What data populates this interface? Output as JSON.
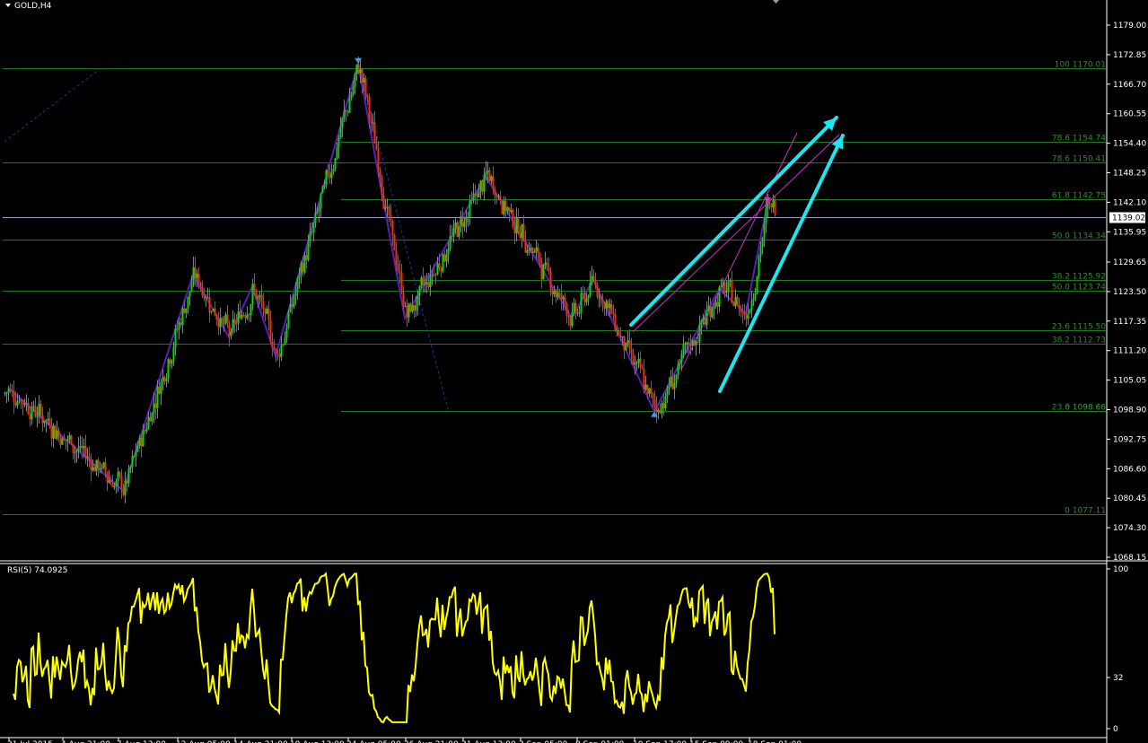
{
  "window": {
    "symbol_label": "GOLD,H4"
  },
  "chart_data": [
    {
      "type": "line",
      "title": "GOLD,H4",
      "chart_style": "candlestick",
      "ylim": [
        1065.1,
        1182.7
      ],
      "price_ticks": [
        "1179.00",
        "1172.85",
        "1166.70",
        "1160.55",
        "1154.40",
        "1148.25",
        "1142.10",
        "1135.95",
        "1129.65",
        "1123.50",
        "1117.35",
        "1111.20",
        "1105.05",
        "1098.90",
        "1092.75",
        "1086.60",
        "1080.45",
        "1074.30",
        "1068.15"
      ],
      "current_price": "1139.02",
      "x_tick_labels": [
        "31 Jul 2015",
        "4 Aug 21:00",
        "7 Aug 13:00",
        "12 Aug 05:00",
        "14 Aug 21:00",
        "19 Aug 13:00",
        "24 Aug 05:00",
        "26 Aug 21:00",
        "31 Aug 13:00",
        "3 Sep 05:00",
        "8 Sep 01:00",
        "10 Sep 17:00",
        "15 Sep 09:00",
        "18 Sep 01:00"
      ],
      "fibonacci_levels": [
        {
          "ratio": "100",
          "price": "1170.01",
          "value": 1170.01
        },
        {
          "ratio": "78.6",
          "price": "1154.74",
          "value": 1154.74
        },
        {
          "ratio": "78.6",
          "price": "1150.41",
          "value": 1150.41
        },
        {
          "ratio": "61.8",
          "price": "1142.75",
          "value": 1142.75
        },
        {
          "ratio": "50.0",
          "price": "1134.34",
          "value": 1134.34
        },
        {
          "ratio": "38.2",
          "price": "1125.92",
          "value": 1125.92
        },
        {
          "ratio": "50.0",
          "price": "1123.74",
          "value": 1123.74
        },
        {
          "ratio": "23.6",
          "price": "1115.50",
          "value": 1115.5
        },
        {
          "ratio": "38.2",
          "price": "1112.73",
          "value": 1112.73
        },
        {
          "ratio": "23.6",
          "price": "1098.66",
          "value": 1098.66
        },
        {
          "ratio": "0",
          "price": "1098.66",
          "value": 1098.66
        },
        {
          "ratio": "0",
          "price": "1077.11",
          "value": 1077.11
        }
      ],
      "zigzag": [
        {
          "bar": 2,
          "price": 1103.5
        },
        {
          "bar": 66,
          "price": 1082.0
        },
        {
          "bar": 105,
          "price": 1127.0
        },
        {
          "bar": 125,
          "price": 1114.0
        },
        {
          "bar": 138,
          "price": 1124.5
        },
        {
          "bar": 151,
          "price": 1110.0
        },
        {
          "bar": 197,
          "price": 1171.0
        },
        {
          "bar": 223,
          "price": 1118.0
        },
        {
          "bar": 268,
          "price": 1147.5
        },
        {
          "bar": 316,
          "price": 1118.0
        },
        {
          "bar": 328,
          "price": 1126.0
        },
        {
          "bar": 362,
          "price": 1098.5
        },
        {
          "bar": 398,
          "price": 1124.0
        },
        {
          "bar": 413,
          "price": 1119.0
        },
        {
          "bar": 425,
          "price": 1142.0
        }
      ],
      "colors": {
        "bull": "#00e000",
        "bear": "#ff2a00",
        "fib": "#1e7a1e",
        "zigzag": "#5a1eb4",
        "channel": "#c832c8",
        "arrow": "#1ee6f0",
        "rsi": "#ffff00",
        "current": "#9aa0c8"
      },
      "series_seed": 7
    },
    {
      "type": "line",
      "title": "RSI(5) 74.0925",
      "ylim": [
        0,
        100
      ],
      "tick_labels": [
        "100",
        "32",
        "0"
      ],
      "series": [
        {
          "name": "RSI(5)",
          "last_value": 74.0925
        }
      ]
    }
  ]
}
